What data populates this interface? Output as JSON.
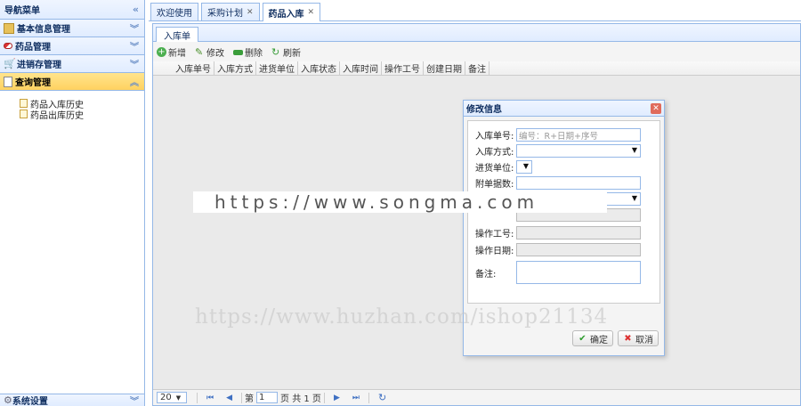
{
  "nav": {
    "title": "导航菜单",
    "sections": [
      {
        "label": "基本信息管理",
        "icon": "folder-icon"
      },
      {
        "label": "药品管理",
        "icon": "pill-icon"
      },
      {
        "label": "进销存管理",
        "icon": "cart-icon"
      },
      {
        "label": "查询管理",
        "icon": "document-icon",
        "active": true
      }
    ],
    "tree_items": [
      "药品入库历史",
      "药品出库历史"
    ],
    "footer": "系统设置"
  },
  "tabs": [
    {
      "label": "欢迎使用",
      "closable": false
    },
    {
      "label": "采购计划",
      "closable": true
    },
    {
      "label": "药品入库",
      "closable": true,
      "active": true
    }
  ],
  "inner_tab": "入库单",
  "toolbar": {
    "add": "新增",
    "edit": "修改",
    "delete": "删除",
    "refresh": "刷新"
  },
  "columns": [
    "入库单号",
    "入库方式",
    "进货单位",
    "入库状态",
    "入库时间",
    "操作工号",
    "创建日期",
    "备注"
  ],
  "pager": {
    "page_size": "20",
    "page_prefix": "第",
    "page_value": "1",
    "page_suffix": "页 共 1 页"
  },
  "dialog": {
    "title": "修改信息",
    "fields": {
      "order_no": {
        "label": "入库单号:",
        "placeholder": "编号：R+日期+序号"
      },
      "method": {
        "label": "入库方式:"
      },
      "supplier": {
        "label": "进货单位:"
      },
      "attachments": {
        "label": "附单据数:"
      },
      "operator": {
        "label": "操作工号:"
      },
      "op_date": {
        "label": "操作日期:"
      },
      "remark": {
        "label": "备注:"
      }
    },
    "ok": "确定",
    "cancel": "取消"
  },
  "watermarks": {
    "top": "https://www.songma.com",
    "bottom": "https://www.huzhan.com/ishop21134"
  },
  "colors": {
    "border": "#95b8e7",
    "header_start": "#eff5ff",
    "active_section": "#ffd260"
  }
}
